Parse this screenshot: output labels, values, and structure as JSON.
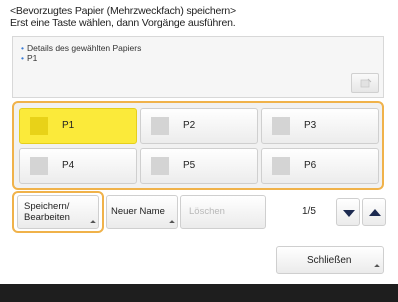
{
  "header": {
    "title": "<Bevorzugtes Papier (Mehrzweckfach) speichern>",
    "instruction": "Erst eine Taste wählen, dann Vorgänge ausführen."
  },
  "details": {
    "label": "Details des gewählten Papiers",
    "value": "P1"
  },
  "papers": [
    {
      "label": "P1",
      "selected": true
    },
    {
      "label": "P2",
      "selected": false
    },
    {
      "label": "P3",
      "selected": false
    },
    {
      "label": "P4",
      "selected": false
    },
    {
      "label": "P5",
      "selected": false
    },
    {
      "label": "P6",
      "selected": false
    }
  ],
  "actions": {
    "save_edit_line1": "Speichern/",
    "save_edit_line2": "Bearbeiten",
    "new_name": "Neuer Name",
    "delete": "Löschen"
  },
  "pagination": {
    "current": "1/5"
  },
  "close_label": "Schließen",
  "colors": {
    "selected": "#fbea3a",
    "highlight_frame": "#f0b24a",
    "arrow": "#1c2a50"
  }
}
